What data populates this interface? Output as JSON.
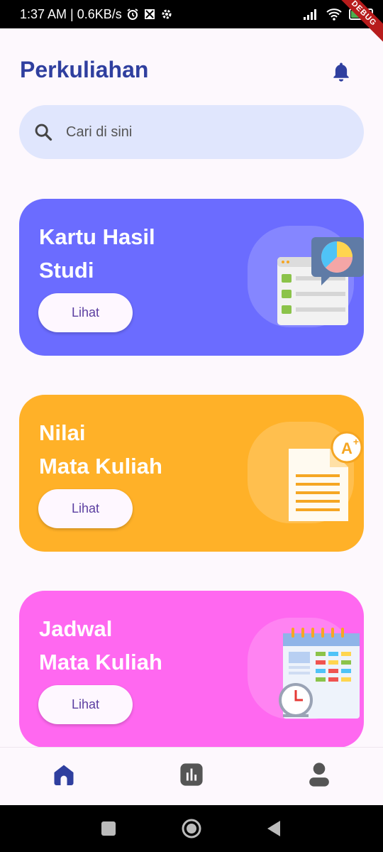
{
  "status_bar": {
    "time_speed": "1:37 AM | 0.6KB/s",
    "battery_level": "90",
    "debug_label": "DEBUG"
  },
  "header": {
    "title": "Perkuliahan",
    "bell_icon": "bell-icon"
  },
  "search": {
    "placeholder": "Cari di sini",
    "icon": "search-icon"
  },
  "cards": [
    {
      "title": "Kartu Hasil\nStudi",
      "button_label": "Lihat",
      "color": "#6b6cff",
      "illustration": "report-chart-icon"
    },
    {
      "title": "Nilai\nMata Kuliah",
      "button_label": "Lihat",
      "color": "#ffb128",
      "illustration": "grade-document-icon"
    },
    {
      "title": "Jadwal\nMata Kuliah",
      "button_label": "Lihat",
      "color": "#ff68f0",
      "illustration": "calendar-clock-icon"
    }
  ],
  "bottom_nav": {
    "items": [
      {
        "icon": "home-icon",
        "active": true
      },
      {
        "icon": "bar-chart-icon",
        "active": false
      },
      {
        "icon": "person-icon",
        "active": false
      }
    ],
    "active_color": "#2f3f9f",
    "inactive_color": "#555555"
  }
}
